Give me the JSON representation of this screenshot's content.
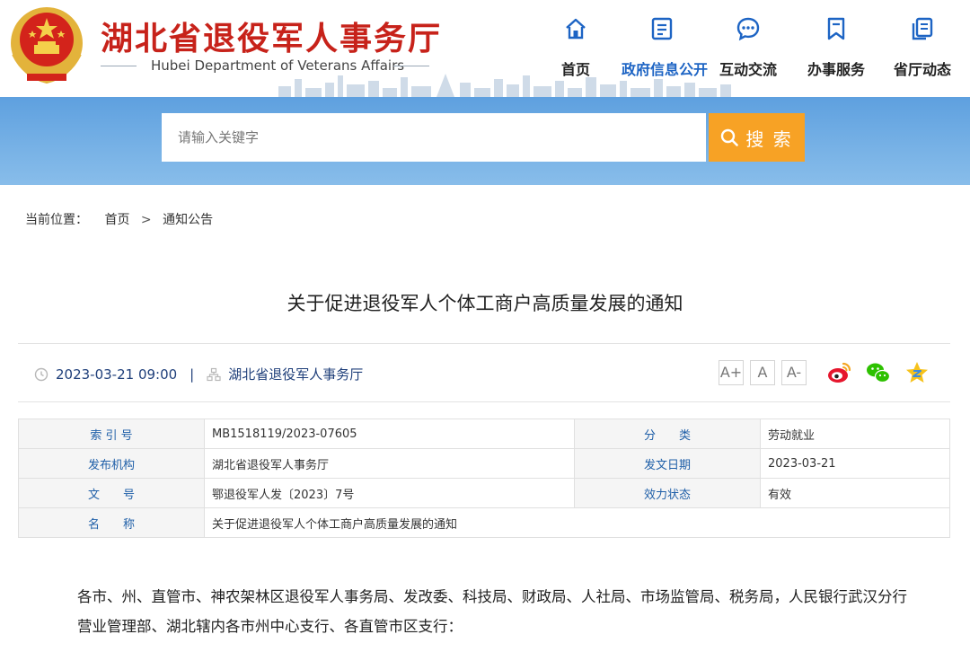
{
  "header": {
    "site_title": "湖北省退役军人事务厅",
    "site_subtitle": "Hubei Department of Veterans Affairs",
    "nav": [
      {
        "label": "首页",
        "icon": "home-icon"
      },
      {
        "label": "政府信息公开",
        "icon": "document-icon",
        "active": true
      },
      {
        "label": "互动交流",
        "icon": "chat-bubble-icon"
      },
      {
        "label": "办事服务",
        "icon": "bookmark-icon"
      },
      {
        "label": "省厅动态",
        "icon": "copy-icon"
      }
    ]
  },
  "search": {
    "placeholder": "请输入关键字",
    "button_label": "搜 索"
  },
  "breadcrumb": {
    "prefix": "当前位置：",
    "home": "首页",
    "separator": ">",
    "current": "通知公告"
  },
  "article": {
    "title": "关于促进退役军人个体工商户高质量发展的通知",
    "datetime": "2023-03-21 09:00",
    "meta_divider": "|",
    "source": "湖北省退役军人事务厅",
    "font_sizes": [
      "A+",
      "A",
      "A-"
    ],
    "share": [
      "weibo-icon",
      "wechat-icon",
      "favorite-star-icon"
    ]
  },
  "info_table": {
    "rows": [
      {
        "k1": "索 引 号",
        "v1": "MB1518119/2023-07605",
        "k2": "分　　类",
        "v2": "劳动就业"
      },
      {
        "k1": "发布机构",
        "v1": "湖北省退役军人事务厅",
        "k2": "发文日期",
        "v2": "2023-03-21"
      },
      {
        "k1": "文　　号",
        "v1": "鄂退役军人发〔2023〕7号",
        "k2": "效力状态",
        "v2": "有效"
      }
    ],
    "name_row": {
      "k": "名　　称",
      "v": "关于促进退役军人个体工商户高质量发展的通知"
    }
  },
  "body": {
    "paragraph_1": "各市、州、直管市、神农架林区退役军人事务局、发改委、科技局、财政局、人社局、市场监管局、税务局，人民银行武汉分行营业管理部、湖北辖内各市州中心支行、各直管市区支行："
  },
  "colors": {
    "title_red": "#c7221a",
    "nav_active": "#1d64c4",
    "search_band": "#6aa8e2",
    "search_button": "#f7a225",
    "table_key": "#1f5fa8"
  }
}
